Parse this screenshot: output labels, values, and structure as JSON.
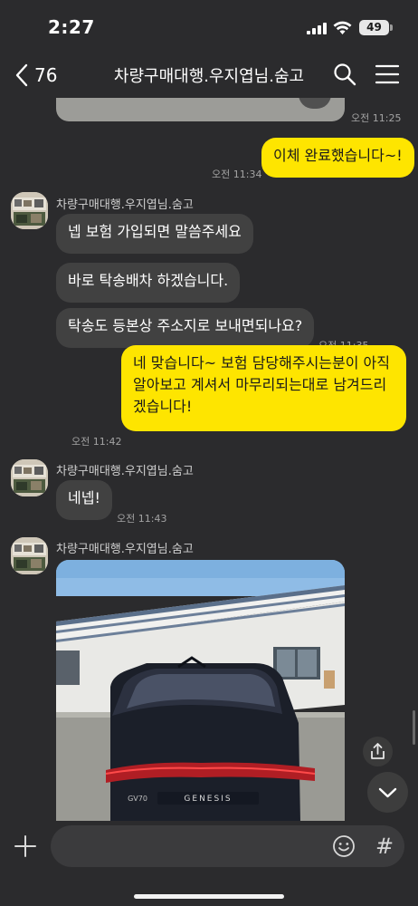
{
  "status_bar": {
    "time": "2:27",
    "battery": "49"
  },
  "header": {
    "back_count": "76",
    "title": "차량구매대행.우지엽님.숨고"
  },
  "messages": {
    "prev_image_time": "오전 11:25",
    "m1_text": "이체 완료했습니다~!",
    "m1_time": "오전 11:34",
    "sender_name": "차량구매대행.우지엽님.숨고",
    "m2_text": "넵 보험  가입되면 말씀주세요",
    "m3_text": "바로 탁송배차 하겠습니다.",
    "m4_text": "탁송도 등본상 주소지로 보내면되나요?",
    "m4_time": "오전 11:35",
    "m5_text": "네 맞습니다~ 보험 담당해주시는분이 아직 알아보고 계셔서 마무리되는대로 남겨드리겠습니다!",
    "m5_time": "오전 11:42",
    "m6_text": "네넵!",
    "m6_time": "오전 11:43",
    "photo_badge": "GV70",
    "photo_emblem": "GENESIS"
  },
  "input": {
    "value": "",
    "hash_label": "#"
  },
  "colors": {
    "background": "#2b2b2d",
    "incoming_bubble": "#414141",
    "outgoing_bubble": "#fee500",
    "timestamp": "#a3a3a3"
  },
  "icons": [
    "back-chevron-icon",
    "search-icon",
    "menu-icon",
    "share-icon",
    "chevron-down-icon",
    "plus-icon",
    "emoji-icon",
    "hash-icon"
  ]
}
